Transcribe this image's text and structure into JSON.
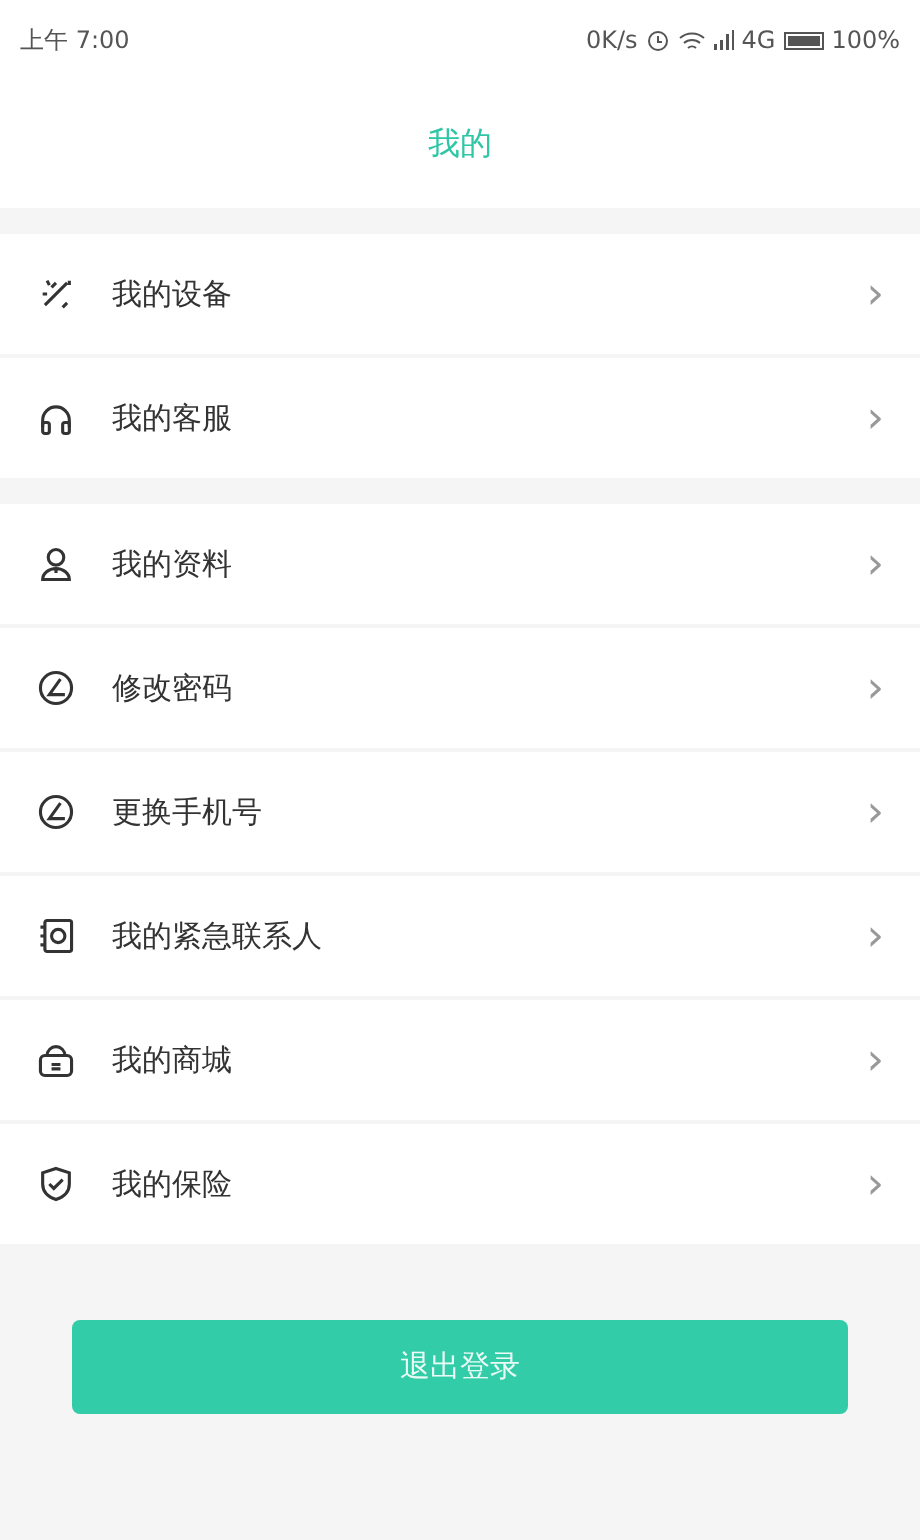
{
  "status_bar": {
    "time": "上午 7:00",
    "speed": "0K/s",
    "network": "4G",
    "battery": "100%"
  },
  "header": {
    "title": "我的"
  },
  "groups": [
    {
      "items": [
        {
          "label": "我的设备",
          "chevron": "›"
        },
        {
          "label": "我的客服",
          "chevron": "›"
        }
      ]
    },
    {
      "items": [
        {
          "label": "我的资料",
          "chevron": "›"
        },
        {
          "label": "修改密码",
          "chevron": "›"
        },
        {
          "label": "更换手机号",
          "chevron": "›"
        },
        {
          "label": "我的紧急联系人",
          "chevron": "›"
        },
        {
          "label": "我的商城",
          "chevron": "›"
        },
        {
          "label": "我的保险",
          "chevron": "›"
        }
      ]
    }
  ],
  "logout_button": "退出登录"
}
